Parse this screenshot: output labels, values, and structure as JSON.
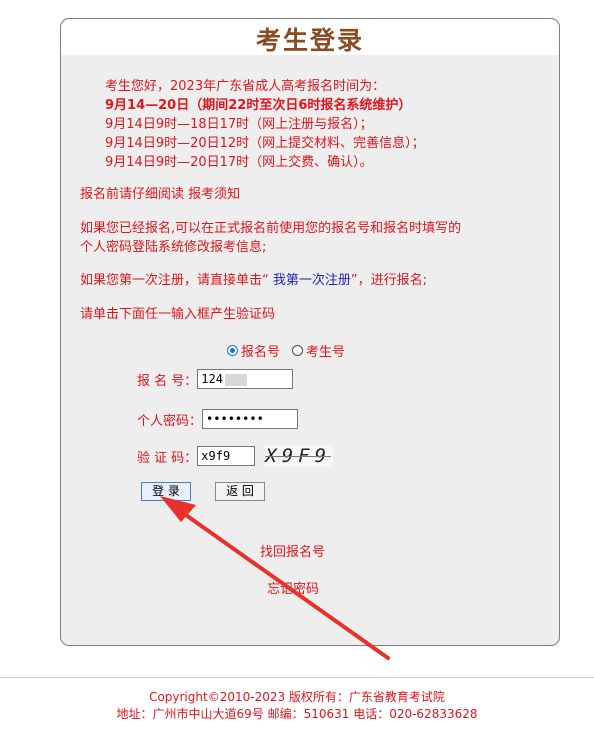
{
  "title": "考生登录",
  "notice": {
    "intro": "考生您好，2023年广东省成人高考报名时间为：",
    "highlight": "9月14—20日（期间22时至次日6时报名系统维护）",
    "line1": "9月14日9时—18日17时（网上注册与报名）；",
    "line2": "9月14日9时—20日12时（网上提交材料、完善信息）；",
    "line3": "9月14日9时—20日17时（网上交费、确认）。"
  },
  "read_notice_prefix": "报名前请仔细阅读 ",
  "read_notice_link": "报考须知",
  "already_registered_line1": "如果您已经报名,可以在正式报名前使用您的报名号和报名时填写的",
  "already_registered_line2": "个人密码登陆系统修改报考信息;",
  "first_time_prefix": "如果您第一次注册，请直接单击“ ",
  "first_time_link": "我第一次注册",
  "first_time_suffix": "”，进行报名;",
  "captcha_hint": "请单击下面任一输入框产生验证码",
  "login_type": {
    "options": [
      "报名号",
      "考生号"
    ],
    "selected": "报名号"
  },
  "form": {
    "reg_no_label": "报 名 号：",
    "reg_no_value": "124",
    "password_label": "个人密码：",
    "password_value": "••••••••",
    "captcha_label": "验 证 码：",
    "captcha_value": "x9f9",
    "captcha_image_text": "X9F9"
  },
  "buttons": {
    "login": "登 录",
    "back": "返 回"
  },
  "links": {
    "retrieve_reg_no": "找回报名号",
    "forgot_password": "忘记密码"
  },
  "footer": {
    "copyright": "Copyright©2010-2023 版权所有：广东省教育考试院",
    "address": "地址：广州市中山大道69号 邮编：510631 电话：020-62833628"
  },
  "colors": {
    "accent_red": "#e3141c",
    "title_brown": "#8a4a22",
    "link_blue": "#1f1fb8",
    "annotation_arrow": "#e8312a"
  }
}
